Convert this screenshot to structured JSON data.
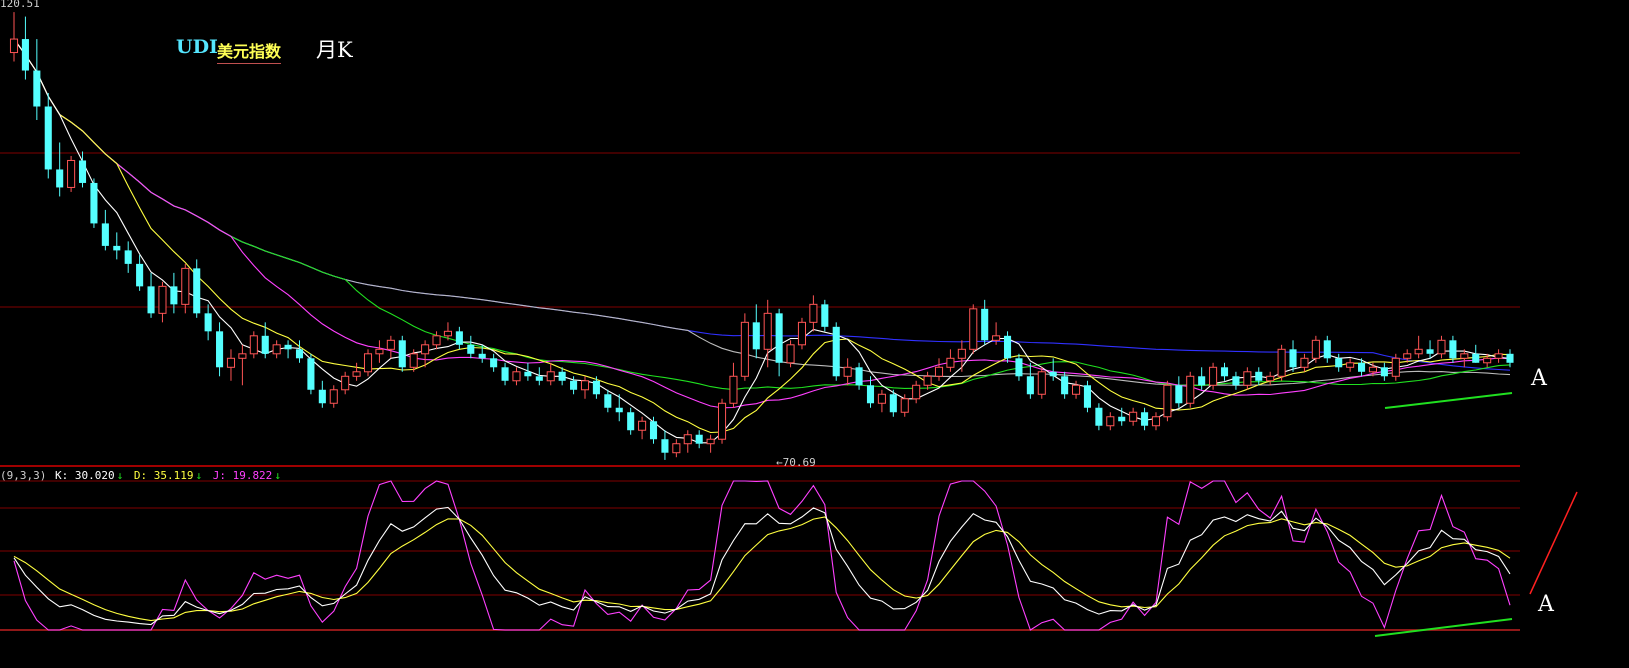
{
  "header": {
    "code": "UDI",
    "name": "美元指数",
    "period": "月K"
  },
  "annotations": {
    "mark_price": "A",
    "mark_kdj": "A"
  },
  "price_labels": {
    "high": "120.51",
    "low": "70.69"
  },
  "kdj_header": {
    "params": "(9,3,3)",
    "k": "K: 30.020",
    "d": "D: 35.119",
    "j": "J: 19.822",
    "arrow_down": "↓"
  },
  "colors": {
    "background": "#000000",
    "candle_up": "#ff5555",
    "candle_down": "#55ffff",
    "ma5": "#ffffff",
    "ma10": "#ffff40",
    "ma20": "#ff40ff",
    "ma30": "#20e020",
    "ma60": "#bbbbbb",
    "ma120": "#3030ff",
    "grid": "#800000",
    "k_line": "#ffffff",
    "d_line": "#ffff40",
    "j_line": "#ff40ff",
    "divergence_line": "#20e020",
    "trend_line": "#ff2020"
  },
  "chart_data": [
    {
      "type": "candlestick",
      "description_period": "monthly",
      "y_range": [
        70.69,
        120.51
      ],
      "grid": true,
      "candles": [
        [
          116.0,
          120.5,
          115.0,
          117.5
        ],
        [
          117.5,
          120.0,
          113.0,
          114.0
        ],
        [
          114.0,
          117.5,
          108.5,
          110.0
        ],
        [
          110.0,
          111.5,
          102.0,
          103.0
        ],
        [
          103.0,
          106.0,
          100.0,
          101.0
        ],
        [
          101.0,
          104.5,
          100.5,
          104.0
        ],
        [
          104.0,
          105.0,
          101.0,
          101.5
        ],
        [
          101.5,
          102.0,
          96.5,
          97.0
        ],
        [
          97.0,
          98.5,
          94.0,
          94.5
        ],
        [
          94.5,
          96.0,
          93.0,
          94.0
        ],
        [
          94.0,
          95.0,
          91.5,
          92.5
        ],
        [
          92.5,
          93.5,
          89.5,
          90.0
        ],
        [
          90.0,
          91.5,
          86.5,
          87.0
        ],
        [
          87.0,
          90.5,
          86.0,
          90.0
        ],
        [
          90.0,
          91.5,
          87.0,
          88.0
        ],
        [
          88.0,
          92.5,
          87.0,
          92.0
        ],
        [
          92.0,
          93.0,
          86.5,
          87.0
        ],
        [
          87.0,
          88.0,
          84.0,
          85.0
        ],
        [
          85.0,
          86.0,
          80.0,
          81.0
        ],
        [
          81.0,
          83.0,
          79.5,
          82.0
        ],
        [
          82.0,
          83.5,
          79.0,
          82.5
        ],
        [
          82.5,
          85.0,
          82.0,
          84.5
        ],
        [
          84.5,
          86.0,
          82.0,
          82.5
        ],
        [
          82.5,
          84.0,
          82.0,
          83.5
        ],
        [
          83.5,
          84.0,
          82.0,
          83.0
        ],
        [
          83.0,
          84.0,
          81.5,
          82.0
        ],
        [
          82.0,
          82.5,
          78.0,
          78.5
        ],
        [
          78.5,
          79.5,
          76.5,
          77.0
        ],
        [
          77.0,
          79.0,
          76.5,
          78.5
        ],
        [
          78.5,
          80.5,
          78.0,
          80.0
        ],
        [
          80.0,
          81.5,
          79.5,
          80.5
        ],
        [
          80.5,
          83.0,
          80.0,
          82.5
        ],
        [
          82.5,
          84.0,
          81.5,
          83.0
        ],
        [
          83.0,
          84.5,
          82.0,
          84.0
        ],
        [
          84.0,
          84.5,
          80.5,
          81.0
        ],
        [
          81.0,
          83.0,
          80.5,
          82.5
        ],
        [
          82.5,
          84.0,
          81.0,
          83.5
        ],
        [
          83.5,
          85.0,
          83.0,
          84.5
        ],
        [
          84.5,
          86.0,
          84.0,
          85.0
        ],
        [
          85.0,
          85.5,
          83.0,
          83.5
        ],
        [
          83.5,
          84.5,
          82.0,
          82.5
        ],
        [
          82.5,
          83.5,
          81.5,
          82.0
        ],
        [
          82.0,
          82.5,
          80.5,
          81.0
        ],
        [
          81.0,
          81.5,
          79.0,
          79.5
        ],
        [
          79.5,
          81.0,
          79.0,
          80.5
        ],
        [
          80.5,
          81.5,
          79.5,
          80.0
        ],
        [
          80.0,
          81.0,
          79.0,
          79.5
        ],
        [
          79.5,
          81.5,
          79.0,
          80.5
        ],
        [
          80.5,
          81.0,
          79.0,
          79.5
        ],
        [
          79.5,
          80.0,
          78.0,
          78.5
        ],
        [
          78.5,
          80.0,
          77.5,
          79.5
        ],
        [
          79.5,
          80.0,
          77.5,
          78.0
        ],
        [
          78.0,
          78.5,
          76.0,
          76.5
        ],
        [
          76.5,
          78.0,
          75.0,
          76.0
        ],
        [
          76.0,
          76.5,
          73.5,
          74.0
        ],
        [
          74.0,
          75.5,
          73.0,
          75.0
        ],
        [
          75.0,
          75.5,
          72.5,
          73.0
        ],
        [
          73.0,
          74.0,
          70.7,
          71.5
        ],
        [
          71.5,
          73.0,
          71.0,
          72.5
        ],
        [
          72.5,
          74.0,
          71.5,
          73.5
        ],
        [
          73.5,
          74.0,
          72.0,
          72.5
        ],
        [
          72.5,
          73.5,
          71.5,
          73.0
        ],
        [
          73.0,
          77.5,
          72.5,
          77.0
        ],
        [
          77.0,
          81.5,
          76.5,
          80.0
        ],
        [
          80.0,
          87.0,
          79.5,
          86.0
        ],
        [
          86.0,
          88.0,
          82.0,
          83.0
        ],
        [
          83.0,
          88.5,
          81.0,
          87.0
        ],
        [
          87.0,
          87.5,
          80.0,
          81.5
        ],
        [
          81.5,
          84.0,
          81.0,
          83.5
        ],
        [
          83.5,
          86.5,
          83.0,
          86.0
        ],
        [
          86.0,
          89.0,
          85.0,
          88.0
        ],
        [
          88.0,
          88.5,
          85.0,
          85.5
        ],
        [
          85.5,
          86.0,
          79.5,
          80.0
        ],
        [
          80.0,
          82.0,
          79.0,
          81.0
        ],
        [
          81.0,
          81.5,
          78.5,
          79.0
        ],
        [
          79.0,
          80.0,
          76.5,
          77.0
        ],
        [
          77.0,
          78.5,
          76.0,
          78.0
        ],
        [
          78.0,
          78.5,
          75.5,
          76.0
        ],
        [
          76.0,
          78.0,
          75.5,
          77.5
        ],
        [
          77.5,
          79.5,
          77.0,
          79.0
        ],
        [
          79.0,
          80.5,
          78.5,
          80.0
        ],
        [
          80.0,
          82.0,
          79.5,
          81.0
        ],
        [
          81.0,
          83.0,
          80.5,
          82.0
        ],
        [
          82.0,
          84.0,
          80.5,
          83.0
        ],
        [
          83.0,
          88.0,
          82.5,
          87.5
        ],
        [
          87.5,
          88.5,
          83.5,
          84.0
        ],
        [
          84.0,
          86.0,
          83.5,
          84.5
        ],
        [
          84.5,
          85.0,
          81.5,
          82.0
        ],
        [
          82.0,
          82.5,
          79.5,
          80.0
        ],
        [
          80.0,
          81.5,
          77.5,
          78.0
        ],
        [
          78.0,
          81.0,
          77.5,
          80.5
        ],
        [
          80.5,
          82.0,
          79.5,
          80.0
        ],
        [
          80.0,
          80.5,
          77.5,
          78.0
        ],
        [
          78.0,
          79.5,
          77.5,
          79.0
        ],
        [
          79.0,
          79.5,
          76.0,
          76.5
        ],
        [
          76.5,
          77.0,
          74.0,
          74.5
        ],
        [
          74.5,
          76.0,
          74.0,
          75.5
        ],
        [
          75.5,
          76.5,
          74.5,
          75.0
        ],
        [
          75.0,
          76.5,
          74.5,
          76.0
        ],
        [
          76.0,
          76.5,
          74.0,
          74.5
        ],
        [
          74.5,
          76.0,
          74.0,
          75.5
        ],
        [
          75.5,
          79.5,
          75.0,
          79.0
        ],
        [
          79.0,
          80.0,
          76.5,
          77.0
        ],
        [
          77.0,
          80.5,
          76.5,
          80.0
        ],
        [
          80.0,
          81.0,
          78.5,
          79.0
        ],
        [
          79.0,
          81.5,
          78.5,
          81.0
        ],
        [
          81.0,
          81.5,
          79.5,
          80.0
        ],
        [
          80.0,
          80.5,
          78.5,
          79.0
        ],
        [
          79.0,
          81.0,
          78.5,
          80.5
        ],
        [
          80.5,
          81.0,
          79.0,
          79.5
        ],
        [
          79.5,
          80.5,
          79.0,
          80.0
        ],
        [
          80.0,
          83.5,
          79.5,
          83.0
        ],
        [
          83.0,
          84.0,
          80.5,
          81.0
        ],
        [
          81.0,
          82.5,
          80.5,
          82.0
        ],
        [
          82.0,
          84.5,
          81.5,
          84.0
        ],
        [
          84.0,
          84.5,
          81.5,
          82.0
        ],
        [
          82.0,
          82.5,
          80.5,
          81.0
        ],
        [
          81.0,
          82.0,
          80.5,
          81.5
        ],
        [
          81.5,
          82.0,
          80.0,
          80.5
        ],
        [
          80.5,
          81.5,
          80.0,
          81.0
        ],
        [
          81.0,
          81.5,
          79.5,
          80.0
        ],
        [
          80.0,
          82.5,
          79.5,
          82.0
        ],
        [
          82.0,
          83.0,
          81.5,
          82.5
        ],
        [
          82.5,
          84.5,
          82.0,
          83.0
        ],
        [
          83.0,
          84.0,
          82.0,
          82.5
        ],
        [
          82.5,
          84.5,
          82.0,
          84.0
        ],
        [
          84.0,
          84.5,
          81.5,
          82.0
        ],
        [
          82.0,
          83.0,
          81.0,
          82.5
        ],
        [
          82.5,
          83.5,
          81.5,
          81.5
        ],
        [
          81.5,
          82.5,
          81.0,
          82.0
        ],
        [
          82.0,
          83.0,
          81.5,
          82.5
        ],
        [
          82.5,
          83.0,
          81.0,
          81.5
        ]
      ],
      "moving_averages": [
        {
          "period": 5,
          "color_key": "ma5"
        },
        {
          "period": 10,
          "color_key": "ma10"
        },
        {
          "period": 20,
          "color_key": "ma20"
        },
        {
          "period": 30,
          "color_key": "ma30"
        },
        {
          "period": 60,
          "color_key": "ma60"
        },
        {
          "period": 120,
          "color_key": "ma120"
        }
      ]
    },
    {
      "type": "line",
      "indicator": "KDJ",
      "y_range": [
        0,
        100
      ],
      "grid": true,
      "k_current": 30.02,
      "d_current": 35.119,
      "j_current": 19.822
    }
  ]
}
